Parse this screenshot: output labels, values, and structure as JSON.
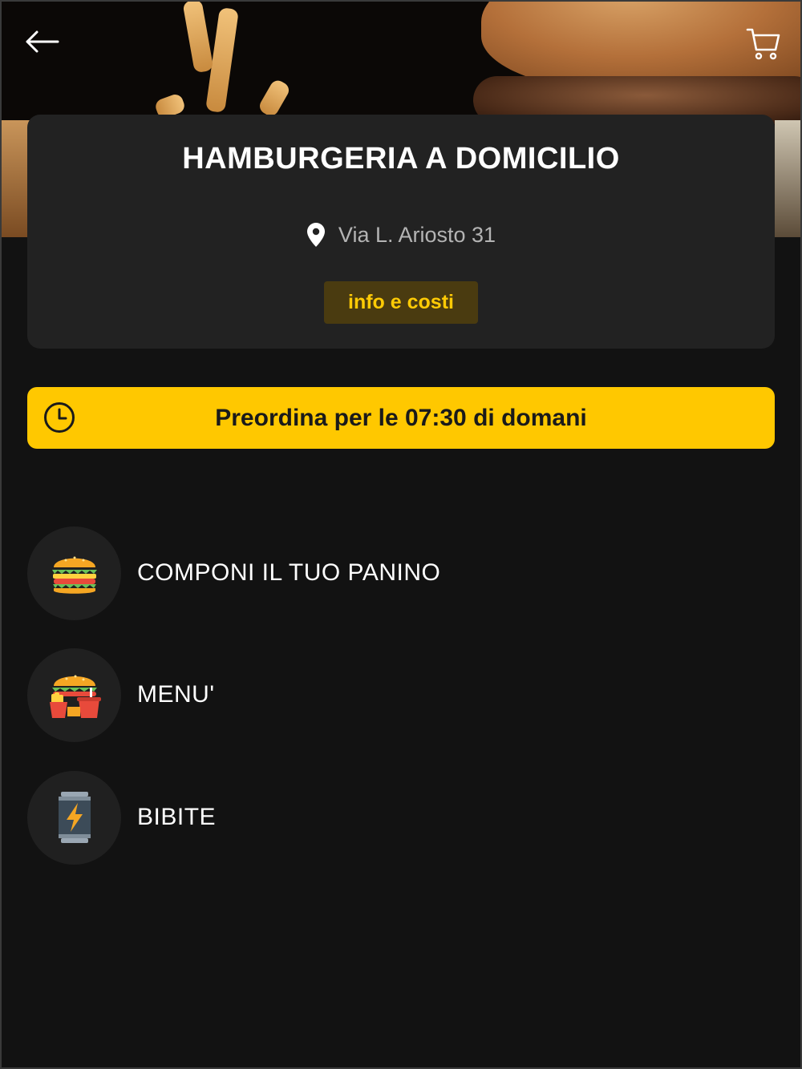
{
  "header": {
    "back_icon": "arrow-left-icon",
    "cart_icon": "cart-icon"
  },
  "restaurant": {
    "name": "HAMBURGERIA A DOMICILIO",
    "address": "Via L. Ariosto 31",
    "info_button_label": "info e costi"
  },
  "preorder": {
    "prefix": "Preordina per le ",
    "time": "07:30",
    "suffix": " di domani",
    "icon": "clock-icon"
  },
  "categories": [
    {
      "label": "COMPONI IL TUO PANINO",
      "icon": "burger-icon"
    },
    {
      "label": "MENU'",
      "icon": "combo-meal-icon"
    },
    {
      "label": "BIBITE",
      "icon": "energy-drink-can-icon"
    }
  ],
  "colors": {
    "background": "#121212",
    "card": "#222222",
    "accent": "#ffc800",
    "info_button_bg": "#4a3b10",
    "info_button_text": "#ffcb05"
  }
}
